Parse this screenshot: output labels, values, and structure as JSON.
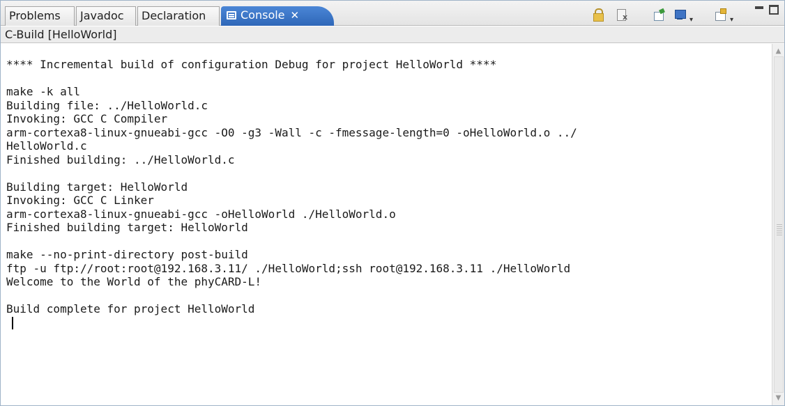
{
  "tabs": [
    {
      "label": "Problems"
    },
    {
      "label": "Javadoc"
    },
    {
      "label": "Declaration"
    },
    {
      "label": "Console",
      "active": true
    }
  ],
  "toolbar_icons": [
    "scroll-lock-icon",
    "clear-console-icon",
    "pin-console-icon",
    "display-console-icon",
    "open-console-icon"
  ],
  "console": {
    "label": "C-Build [HelloWorld]",
    "lines": [
      "**** Incremental build of configuration Debug for project HelloWorld ****",
      "",
      "make -k all",
      "Building file: ../HelloWorld.c",
      "Invoking: GCC C Compiler",
      "arm-cortexa8-linux-gnueabi-gcc -O0 -g3 -Wall -c -fmessage-length=0 -oHelloWorld.o ../",
      "HelloWorld.c",
      "Finished building: ../HelloWorld.c",
      "",
      "Building target: HelloWorld",
      "Invoking: GCC C Linker",
      "arm-cortexa8-linux-gnueabi-gcc -oHelloWorld ./HelloWorld.o",
      "Finished building target: HelloWorld",
      "",
      "make --no-print-directory post-build",
      "ftp -u ftp://root:root@192.168.3.11/ ./HelloWorld;ssh root@192.168.3.11 ./HelloWorld",
      "Welcome to the World of the phyCARD-L!",
      "",
      "Build complete for project HelloWorld"
    ]
  },
  "colors": {
    "active_tab": "#3b76c8",
    "tab_bar": "#e9e9e9",
    "console_bg": "#ffffff"
  }
}
